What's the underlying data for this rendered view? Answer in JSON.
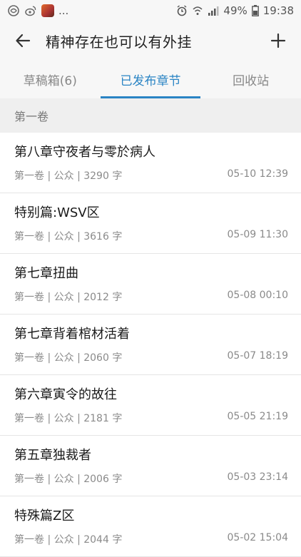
{
  "statusbar": {
    "left_dots": "...",
    "battery": "49%",
    "time": "19:38"
  },
  "header": {
    "title": "精神存在也可以有外挂",
    "back_icon": "arrow-left-icon",
    "add_icon": "plus-icon"
  },
  "tabs": [
    {
      "label": "草稿箱(6)",
      "active": false
    },
    {
      "label": "已发布章节",
      "active": true
    },
    {
      "label": "回收站",
      "active": false
    }
  ],
  "colors": {
    "accent": "#2a84c4"
  },
  "section": {
    "label": "第一卷"
  },
  "chapters": [
    {
      "title": "第八章守夜者与零於病人",
      "meta": "第一卷 | 公众 | 3290 字",
      "date": "05-10 12:39"
    },
    {
      "title": "特别篇:WSV区",
      "meta": "第一卷 | 公众 | 3616 字",
      "date": "05-09 11:30"
    },
    {
      "title": "第七章扭曲",
      "meta": "第一卷 | 公众 | 2012 字",
      "date": "05-08 00:10"
    },
    {
      "title": "第七章背着棺材活着",
      "meta": "第一卷 | 公众 | 2060 字",
      "date": "05-07 18:19"
    },
    {
      "title": "第六章寅令的故往",
      "meta": "第一卷 | 公众 | 2181 字",
      "date": "05-05 21:19"
    },
    {
      "title": "第五章独裁者",
      "meta": "第一卷 | 公众 | 2006 字",
      "date": "05-03 23:14"
    },
    {
      "title": "特殊篇Z区",
      "meta": "第一卷 | 公众 | 2044 字",
      "date": "05-02 15:04"
    }
  ]
}
